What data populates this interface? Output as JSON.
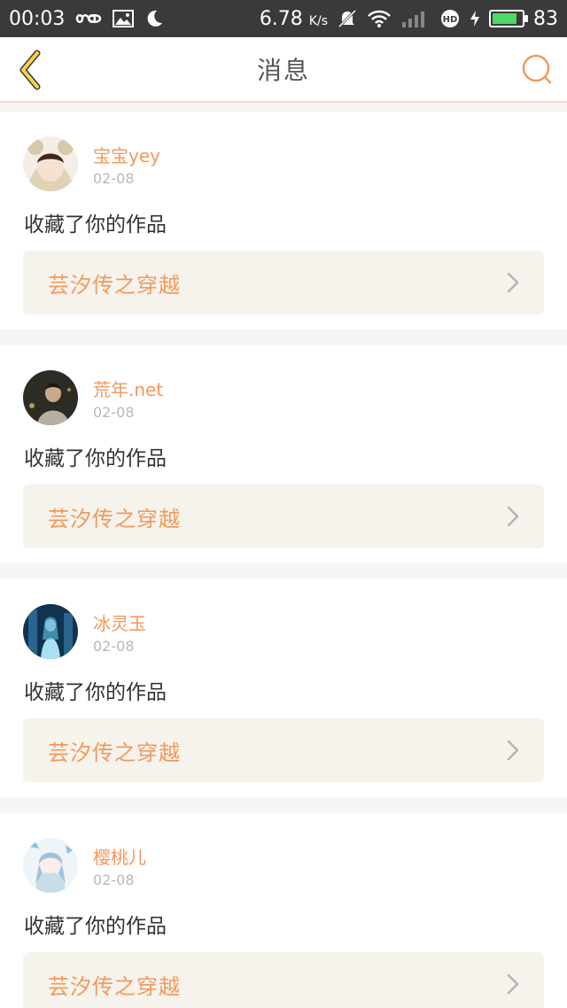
{
  "status_bar": {
    "time": "00:03",
    "speed_value": "6.78",
    "speed_unit": "K/s",
    "battery_level": "83",
    "battery_fraction": 0.83
  },
  "header": {
    "title": "消息"
  },
  "icons": {
    "back": "chevron-left-icon",
    "search": "search-icon",
    "chevron": "chevron-right-icon"
  },
  "colors": {
    "accent": "#f2995c",
    "back_icon": "#f7d54a",
    "status_bar": "#3a3a3a",
    "work_bg": "#f5f3ec"
  },
  "messages": [
    {
      "username": "宝宝yey",
      "date": "02-08",
      "action": "收藏了你的作品",
      "work_title": "芸汐传之穿越"
    },
    {
      "username": "荒年.net",
      "date": "02-08",
      "action": "收藏了你的作品",
      "work_title": "芸汐传之穿越"
    },
    {
      "username": "冰灵玉",
      "date": "02-08",
      "action": "收藏了你的作品",
      "work_title": "芸汐传之穿越"
    },
    {
      "username": "樱桃儿",
      "date": "02-08",
      "action": "收藏了你的作品",
      "work_title": "芸汐传之穿越"
    }
  ]
}
